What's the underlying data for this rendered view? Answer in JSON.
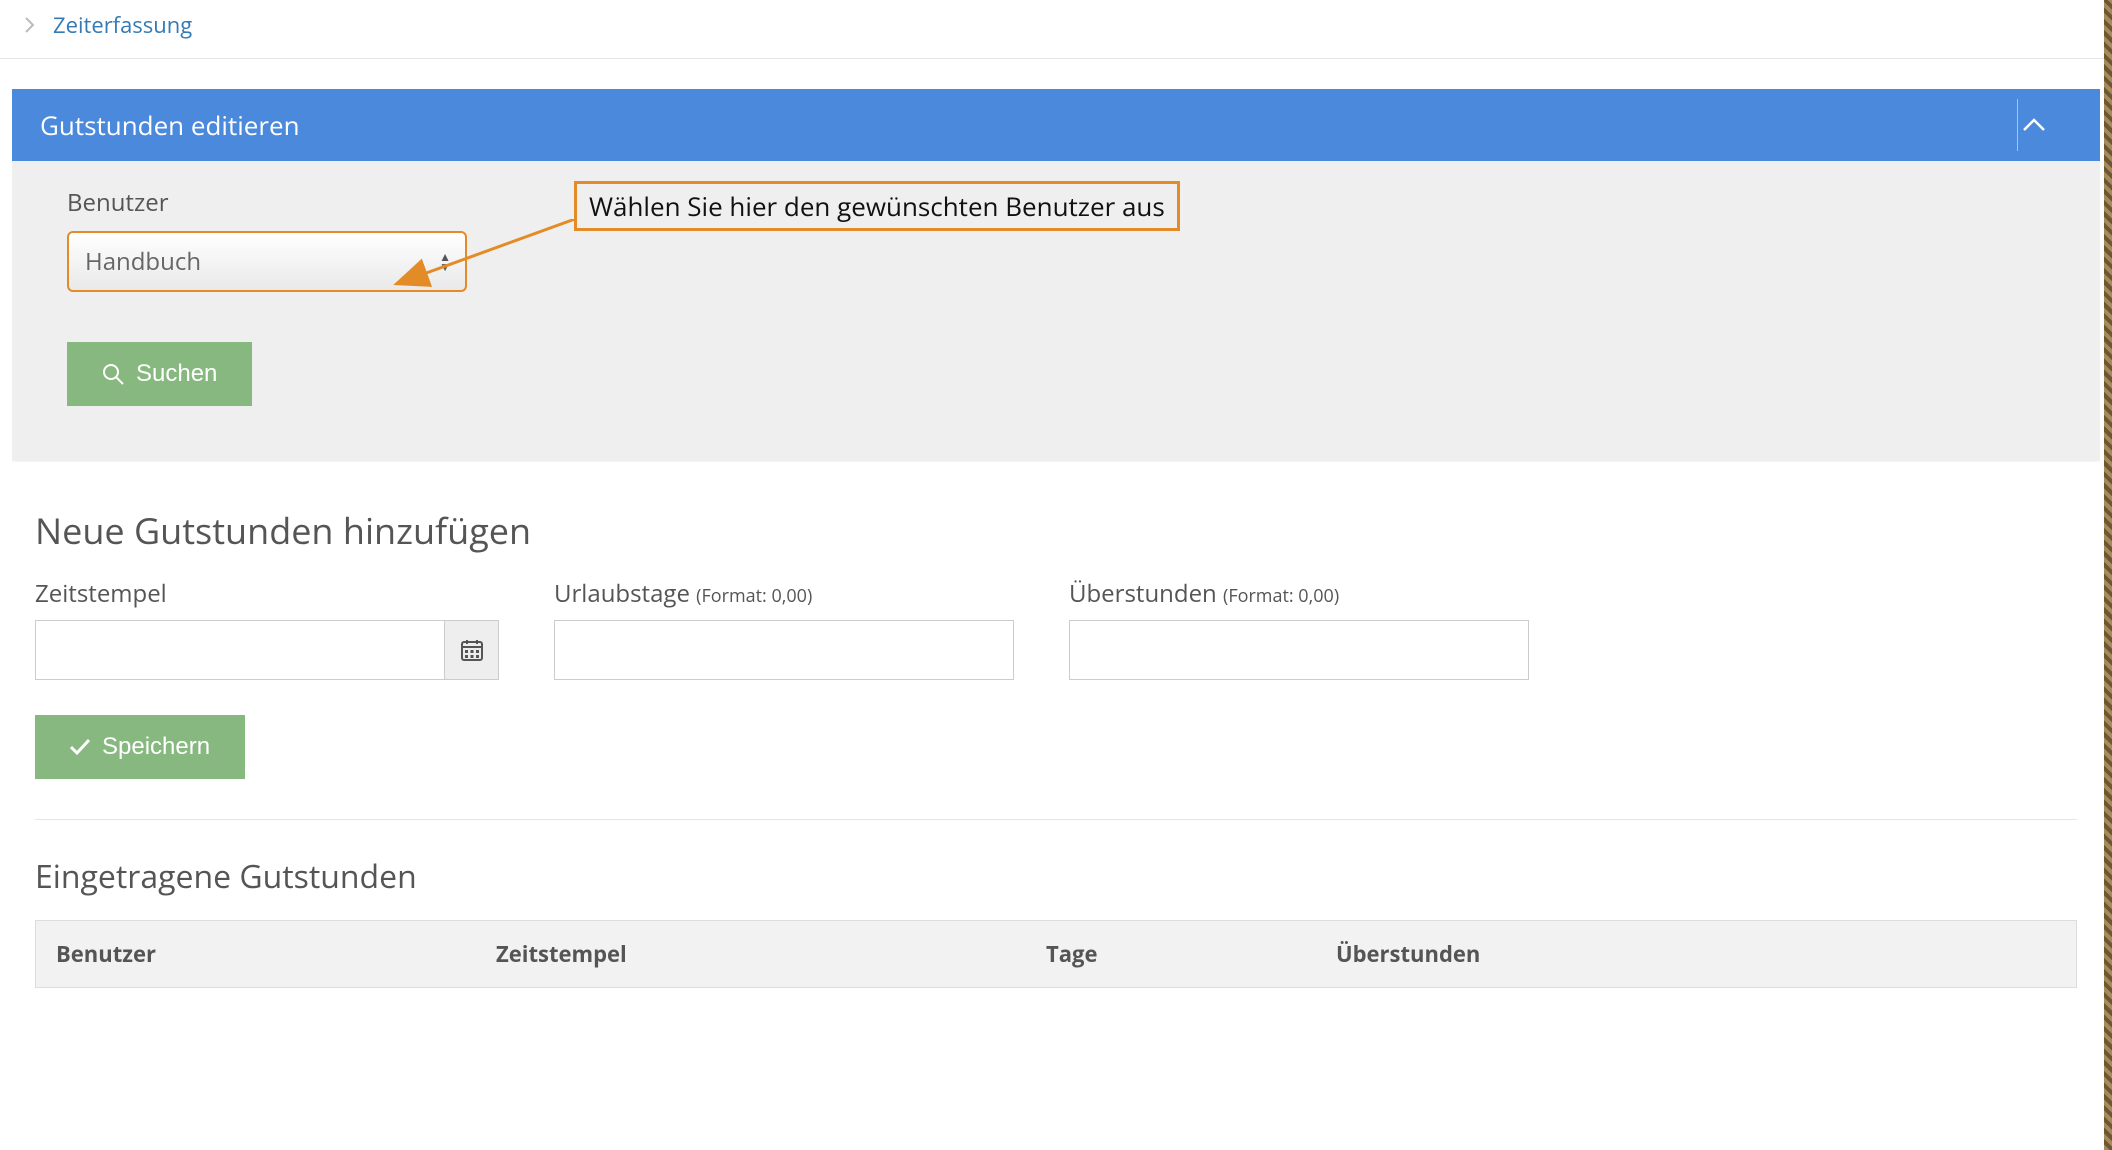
{
  "breadcrumb": {
    "item": "Zeiterfassung"
  },
  "panel": {
    "title": "Gutstunden editieren",
    "user_label": "Benutzer",
    "user_selected": "Handbuch",
    "search_label": "Suchen",
    "callout_text": "Wählen Sie hier den gewünschten Benutzer aus"
  },
  "add_section": {
    "title": "Neue Gutstunden hinzufügen",
    "timestamp_label": "Zeitstempel",
    "vacation_label": "Urlaubstage",
    "overtime_label": "Überstunden",
    "format_hint": "(Format: 0,00)",
    "save_label": "Speichern"
  },
  "list_section": {
    "title": "Eingetragene Gutstunden",
    "columns": {
      "user": "Benutzer",
      "timestamp": "Zeitstempel",
      "days": "Tage",
      "overtime": "Überstunden"
    }
  }
}
